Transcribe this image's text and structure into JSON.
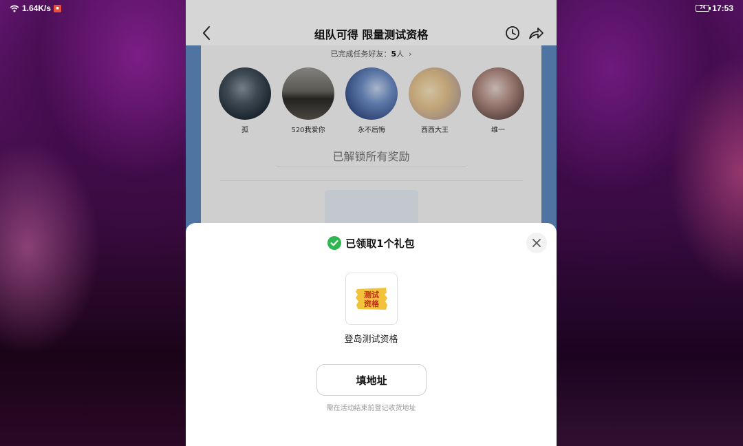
{
  "status_bar": {
    "net_speed": "1.64K/s",
    "battery": "74",
    "time": "17:53"
  },
  "page": {
    "title": "组队可得 限量测试资格",
    "friends_prefix": "已完成任务好友：",
    "friends_count": "5",
    "friends_suffix": "人",
    "unlocked_text": "已解锁所有奖励"
  },
  "friends": [
    {
      "name": "孤",
      "color": "#3a4450"
    },
    {
      "name": "520我爱你",
      "color": "#4d4a42"
    },
    {
      "name": "永不后悔",
      "color": "#3f5f93"
    },
    {
      "name": "西西大王",
      "color": "#d9b98a"
    },
    {
      "name": "维一",
      "color": "#8b6b60"
    }
  ],
  "modal": {
    "title": "已领取1个礼包",
    "gift_icon_text_1": "测试",
    "gift_icon_text_2": "资格",
    "gift_name": "登岛测试资格",
    "button_label": "填地址",
    "hint": "需在活动结束前登记收货地址",
    "accent_green": "#2fb650"
  }
}
